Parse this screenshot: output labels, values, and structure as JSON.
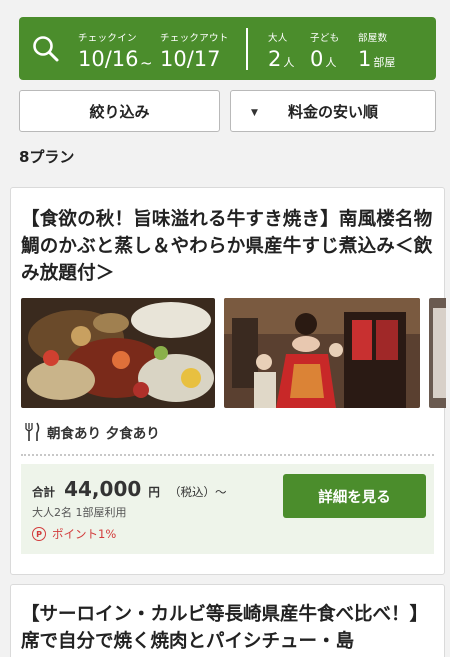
{
  "search": {
    "checkin_label": "チェックイン",
    "checkin_value": "10/16",
    "separator": "~",
    "checkout_label": "チェックアウト",
    "checkout_value": "10/17",
    "adults_label": "大人",
    "adults_value": "2",
    "adults_unit": "人",
    "children_label": "子ども",
    "children_value": "0",
    "children_unit": "人",
    "rooms_label": "部屋数",
    "rooms_value": "1",
    "rooms_unit": "部屋"
  },
  "toolbar": {
    "filter_label": "絞り込み",
    "sort_label": "料金の安い順"
  },
  "results": {
    "count_label": "8プラン"
  },
  "plans": [
    {
      "title": "【食欲の秋！旨味溢れる牛すき焼き】南風楼名物鯛のかぶと蒸し＆やわらか県産牛すじ煮込み＜飲み放題付＞",
      "meals": "朝食あり 夕食あり",
      "price_label": "合計",
      "price": "44,000",
      "price_unit": "円",
      "price_tax": "（税込）～",
      "price_sub": "大人2名 1部屋利用",
      "points": "ポイント1%",
      "detail_button": "詳細を見る"
    },
    {
      "title": "【サーロイン・カルビ等長崎県産牛食べ比べ！】席で自分で焼く焼肉とパイシチュー・島"
    }
  ],
  "colors": {
    "brand_green": "#4b8d2c",
    "price_bg": "#eef4ea",
    "points_red": "#d23c3c"
  }
}
